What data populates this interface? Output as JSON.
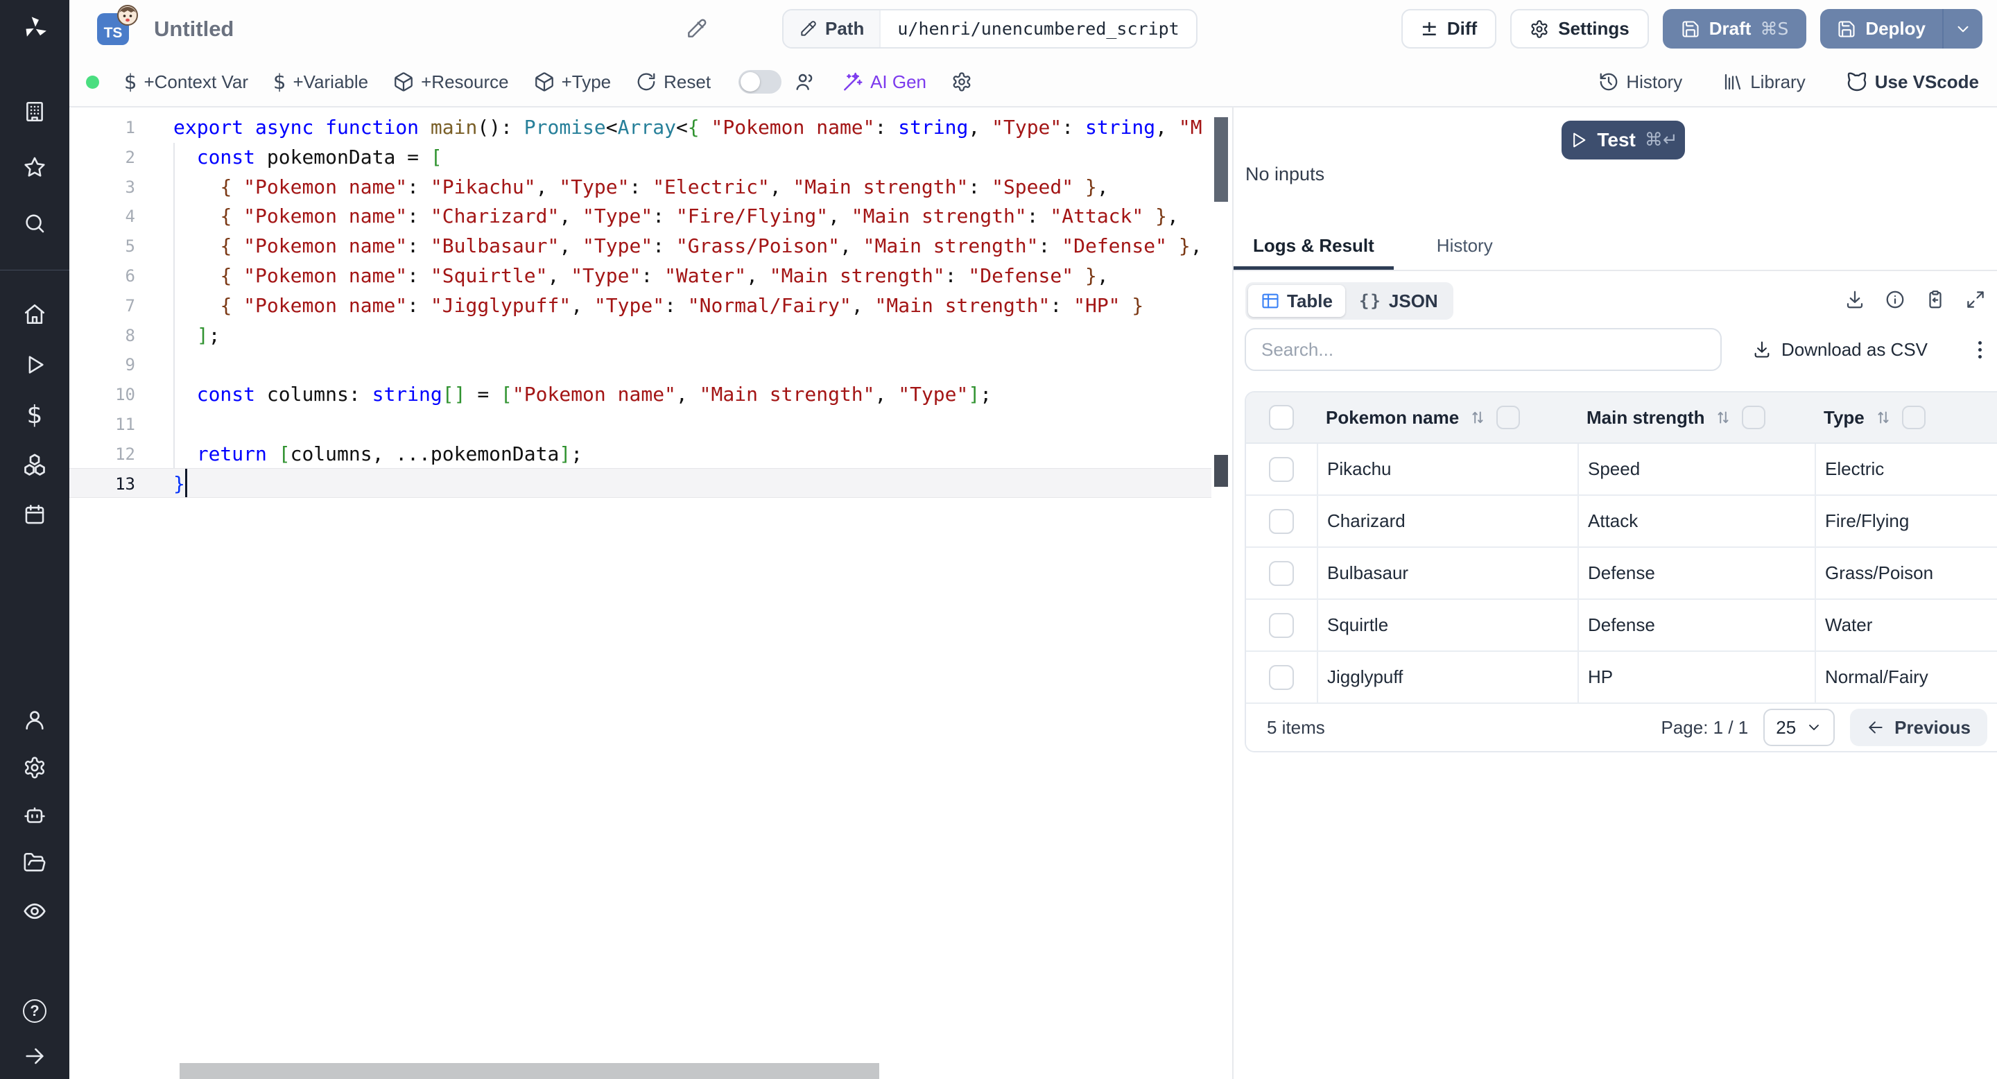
{
  "colors": {
    "sidebar_bg": "#21252e",
    "slate_button": "#6b83aa",
    "test_button": "#3d4e6e",
    "ai_purple": "#7c3aed",
    "table_icon_blue": "#3b82f6",
    "status_dot_green": "#4ade80",
    "ts_badge_blue": "#4a7cc9",
    "string_token": "#a31515",
    "keyword_token": "#0000ff"
  },
  "sidebar": {
    "icons": [
      "windmill-logo",
      "building",
      "star",
      "search",
      "home",
      "play",
      "dollar",
      "boxes",
      "calendar",
      "user",
      "settings",
      "robot",
      "folder-open",
      "eye",
      "help",
      "arrow-right"
    ]
  },
  "topbar": {
    "language_badge": "TS",
    "title": "Untitled",
    "path_label": "Path",
    "path_value": "u/henri/unencumbered_script",
    "diff_label": "Diff",
    "settings_label": "Settings",
    "draft_label": "Draft",
    "draft_shortcut": "⌘S",
    "deploy_label": "Deploy"
  },
  "toolbar": {
    "context_var": "+Context Var",
    "variable": "+Variable",
    "resource": "+Resource",
    "type": "+Type",
    "reset": "Reset",
    "ai_gen": "AI Gen",
    "toggle_on": false,
    "history": "History",
    "library": "Library",
    "use_vscode": "Use VScode"
  },
  "editor": {
    "language": "typescript",
    "active_line": 13,
    "lines": [
      [
        [
          "kw",
          "export"
        ],
        [
          "pl",
          " "
        ],
        [
          "kw",
          "async"
        ],
        [
          "pl",
          " "
        ],
        [
          "kw",
          "function"
        ],
        [
          "pl",
          " "
        ],
        [
          "fn",
          "main"
        ],
        [
          "pl",
          "(): "
        ],
        [
          "ty",
          "Promise"
        ],
        [
          "pl",
          "<"
        ],
        [
          "ty",
          "Array"
        ],
        [
          "pl",
          "<"
        ],
        [
          "b2",
          "{"
        ],
        [
          "pl",
          " "
        ],
        [
          "str",
          "\"Pokemon name\""
        ],
        [
          "pl",
          ": "
        ],
        [
          "kw",
          "string"
        ],
        [
          "pl",
          ", "
        ],
        [
          "str",
          "\"Type\""
        ],
        [
          "pl",
          ": "
        ],
        [
          "kw",
          "string"
        ],
        [
          "pl",
          ", "
        ],
        [
          "str",
          "\"M"
        ]
      ],
      [
        [
          "pl",
          "  "
        ],
        [
          "kw",
          "const"
        ],
        [
          "pl",
          " pokemonData = "
        ],
        [
          "b2",
          "["
        ]
      ],
      [
        [
          "pl",
          "    "
        ],
        [
          "b3",
          "{"
        ],
        [
          "pl",
          " "
        ],
        [
          "str",
          "\"Pokemon name\""
        ],
        [
          "pl",
          ": "
        ],
        [
          "str",
          "\"Pikachu\""
        ],
        [
          "pl",
          ", "
        ],
        [
          "str",
          "\"Type\""
        ],
        [
          "pl",
          ": "
        ],
        [
          "str",
          "\"Electric\""
        ],
        [
          "pl",
          ", "
        ],
        [
          "str",
          "\"Main strength\""
        ],
        [
          "pl",
          ": "
        ],
        [
          "str",
          "\"Speed\""
        ],
        [
          "pl",
          " "
        ],
        [
          "b3",
          "}"
        ],
        [
          "pl",
          ","
        ]
      ],
      [
        [
          "pl",
          "    "
        ],
        [
          "b3",
          "{"
        ],
        [
          "pl",
          " "
        ],
        [
          "str",
          "\"Pokemon name\""
        ],
        [
          "pl",
          ": "
        ],
        [
          "str",
          "\"Charizard\""
        ],
        [
          "pl",
          ", "
        ],
        [
          "str",
          "\"Type\""
        ],
        [
          "pl",
          ": "
        ],
        [
          "str",
          "\"Fire/Flying\""
        ],
        [
          "pl",
          ", "
        ],
        [
          "str",
          "\"Main strength\""
        ],
        [
          "pl",
          ": "
        ],
        [
          "str",
          "\"Attack\""
        ],
        [
          "pl",
          " "
        ],
        [
          "b3",
          "}"
        ],
        [
          "pl",
          ","
        ]
      ],
      [
        [
          "pl",
          "    "
        ],
        [
          "b3",
          "{"
        ],
        [
          "pl",
          " "
        ],
        [
          "str",
          "\"Pokemon name\""
        ],
        [
          "pl",
          ": "
        ],
        [
          "str",
          "\"Bulbasaur\""
        ],
        [
          "pl",
          ", "
        ],
        [
          "str",
          "\"Type\""
        ],
        [
          "pl",
          ": "
        ],
        [
          "str",
          "\"Grass/Poison\""
        ],
        [
          "pl",
          ", "
        ],
        [
          "str",
          "\"Main strength\""
        ],
        [
          "pl",
          ": "
        ],
        [
          "str",
          "\"Defense\""
        ],
        [
          "pl",
          " "
        ],
        [
          "b3",
          "}"
        ],
        [
          "pl",
          ","
        ]
      ],
      [
        [
          "pl",
          "    "
        ],
        [
          "b3",
          "{"
        ],
        [
          "pl",
          " "
        ],
        [
          "str",
          "\"Pokemon name\""
        ],
        [
          "pl",
          ": "
        ],
        [
          "str",
          "\"Squirtle\""
        ],
        [
          "pl",
          ", "
        ],
        [
          "str",
          "\"Type\""
        ],
        [
          "pl",
          ": "
        ],
        [
          "str",
          "\"Water\""
        ],
        [
          "pl",
          ", "
        ],
        [
          "str",
          "\"Main strength\""
        ],
        [
          "pl",
          ": "
        ],
        [
          "str",
          "\"Defense\""
        ],
        [
          "pl",
          " "
        ],
        [
          "b3",
          "}"
        ],
        [
          "pl",
          ","
        ]
      ],
      [
        [
          "pl",
          "    "
        ],
        [
          "b3",
          "{"
        ],
        [
          "pl",
          " "
        ],
        [
          "str",
          "\"Pokemon name\""
        ],
        [
          "pl",
          ": "
        ],
        [
          "str",
          "\"Jigglypuff\""
        ],
        [
          "pl",
          ", "
        ],
        [
          "str",
          "\"Type\""
        ],
        [
          "pl",
          ": "
        ],
        [
          "str",
          "\"Normal/Fairy\""
        ],
        [
          "pl",
          ", "
        ],
        [
          "str",
          "\"Main strength\""
        ],
        [
          "pl",
          ": "
        ],
        [
          "str",
          "\"HP\""
        ],
        [
          "pl",
          " "
        ],
        [
          "b3",
          "}"
        ]
      ],
      [
        [
          "pl",
          "  "
        ],
        [
          "b2",
          "]"
        ],
        [
          "pl",
          ";"
        ]
      ],
      [],
      [
        [
          "pl",
          "  "
        ],
        [
          "kw",
          "const"
        ],
        [
          "pl",
          " columns: "
        ],
        [
          "kw",
          "string"
        ],
        [
          "b2",
          "[]"
        ],
        [
          "pl",
          " = "
        ],
        [
          "b2",
          "["
        ],
        [
          "str",
          "\"Pokemon name\""
        ],
        [
          "pl",
          ", "
        ],
        [
          "str",
          "\"Main strength\""
        ],
        [
          "pl",
          ", "
        ],
        [
          "str",
          "\"Type\""
        ],
        [
          "b2",
          "]"
        ],
        [
          "pl",
          ";"
        ]
      ],
      [],
      [
        [
          "pl",
          "  "
        ],
        [
          "kw",
          "return"
        ],
        [
          "pl",
          " "
        ],
        [
          "b2",
          "["
        ],
        [
          "pl",
          "columns, ...pokemonData"
        ],
        [
          "b2",
          "]"
        ],
        [
          "pl",
          ";"
        ]
      ],
      [
        [
          "b1",
          "}"
        ]
      ]
    ]
  },
  "run": {
    "test_label": "Test",
    "test_shortcut": "⌘↵",
    "no_inputs": "No inputs"
  },
  "result_tabs": {
    "logs_result": "Logs & Result",
    "history": "History",
    "active": "Logs & Result"
  },
  "result": {
    "view_table": "Table",
    "view_json": "JSON",
    "search_placeholder": "Search...",
    "download_csv": "Download as CSV"
  },
  "table": {
    "columns": [
      "Pokemon name",
      "Main strength",
      "Type"
    ],
    "rows": [
      {
        "name": "Pikachu",
        "strength": "Speed",
        "type": "Electric"
      },
      {
        "name": "Charizard",
        "strength": "Attack",
        "type": "Fire/Flying"
      },
      {
        "name": "Bulbasaur",
        "strength": "Defense",
        "type": "Grass/Poison"
      },
      {
        "name": "Squirtle",
        "strength": "Defense",
        "type": "Water"
      },
      {
        "name": "Jigglypuff",
        "strength": "HP",
        "type": "Normal/Fairy"
      }
    ],
    "footer": {
      "items": "5 items",
      "page": "Page: 1 / 1",
      "page_size": "25",
      "previous": "Previous"
    }
  }
}
